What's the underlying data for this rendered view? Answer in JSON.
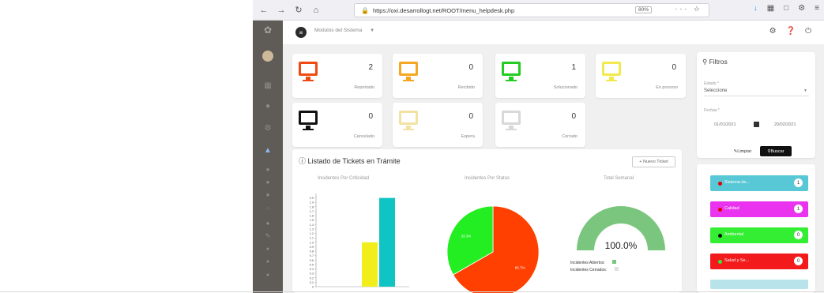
{
  "browser": {
    "url": "https://oxi.desarrollogt.net/ROOT/menu_helpdesk.php",
    "zoom": "80%",
    "nav_icons": [
      "back-icon",
      "forward-icon",
      "reload-icon",
      "home-icon"
    ],
    "toolbar_icons": [
      "download-icon",
      "library-icon",
      "reader-icon",
      "extension-icon",
      "menu-icon"
    ]
  },
  "app": {
    "module_select": "Modulos del Sistema",
    "top_icons": [
      "settings-icon",
      "help-icon",
      "power-icon"
    ],
    "sidebar_icons": [
      "logo-icon",
      "avatar",
      "dashboard-icon",
      "users-icon",
      "settings-icon",
      "bank-icon",
      "tag-icon",
      "tag-icon",
      "tag-icon",
      "circle-icon",
      "person-icon",
      "edit-icon",
      "circle-icon",
      "circle-icon",
      "circle-icon"
    ]
  },
  "stats": [
    {
      "label": "Reportado",
      "count": "2",
      "color": "#f04a13"
    },
    {
      "label": "Recibido",
      "count": "0",
      "color": "#f5a623"
    },
    {
      "label": "Solucionado",
      "count": "1",
      "color": "#22cc22"
    },
    {
      "label": "En proceso",
      "count": "0",
      "color": "#f2e94e"
    },
    {
      "label": "Cancelado",
      "count": "0",
      "color": "#111111"
    },
    {
      "label": "Espera",
      "count": "0",
      "color": "#f3e3a3"
    },
    {
      "label": "Cerrado",
      "count": "0",
      "color": "#d8d8d8"
    }
  ],
  "tickets": {
    "title": "Listado de Tickets en Trámite",
    "new_button": "+ Nuevo Ticket",
    "bar_title": "Incidentes Por Criticidad",
    "pie_title": "Incidentes Por Status",
    "gauge_title": "Total Semanal",
    "gauge_value": "100.0%",
    "legend": [
      {
        "label": "Incidentes Abiertos:",
        "color": "#7bc67e"
      },
      {
        "label": "Incidentes Cerrados:",
        "color": "#e0e0e0"
      }
    ]
  },
  "chart_data": [
    {
      "type": "bar",
      "title": "Incidentes Por Criticidad",
      "y_ticks": [
        "0",
        "0.1",
        "0.2",
        "0.3",
        "0.4",
        "0.5",
        "0.6",
        "0.7",
        "0.8",
        "0.9",
        "1.0",
        "1.1",
        "1.2",
        "1.3",
        "1.4",
        "1.5",
        "1.6",
        "1.7",
        "1.8",
        "1.9",
        "2.0"
      ],
      "series": [
        {
          "values": [
            1
          ],
          "color": "#f2ee1c"
        },
        {
          "values": [
            2
          ],
          "color": "#11c4c4"
        }
      ],
      "ylim": [
        0,
        2.1
      ]
    },
    {
      "type": "pie",
      "title": "Incidentes Por Status",
      "slices": [
        {
          "value": 66.7,
          "color": "#ff4000",
          "label": "66.7%"
        },
        {
          "value": 33.3,
          "color": "#22ee22",
          "label": "33.3%"
        }
      ]
    },
    {
      "type": "gauge",
      "title": "Total Semanal",
      "value": 100.0,
      "color": "#7bc67e"
    }
  ],
  "filters": {
    "title": "Filtros",
    "status_label": "Estado *",
    "status_value": "Seleccione",
    "dates_label": "Fechas *",
    "date_from": "01/01/2021",
    "date_to": "20/02/2021",
    "clear_button": "Limpiar",
    "search_button": "Buscar"
  },
  "categories": [
    {
      "label": "Sistema de...",
      "count": "1",
      "bg": "#59c8d6",
      "dot": "#e00000"
    },
    {
      "label": "Calidad",
      "count": "1",
      "bg": "#ea33ee",
      "dot": "#e00000"
    },
    {
      "label": "Ambiental",
      "count": "0",
      "bg": "#33ee33",
      "dot": "#111111"
    },
    {
      "label": "Salud y Se...",
      "count": "0",
      "bg": "#f21a1a",
      "dot": "#33ee33"
    }
  ]
}
